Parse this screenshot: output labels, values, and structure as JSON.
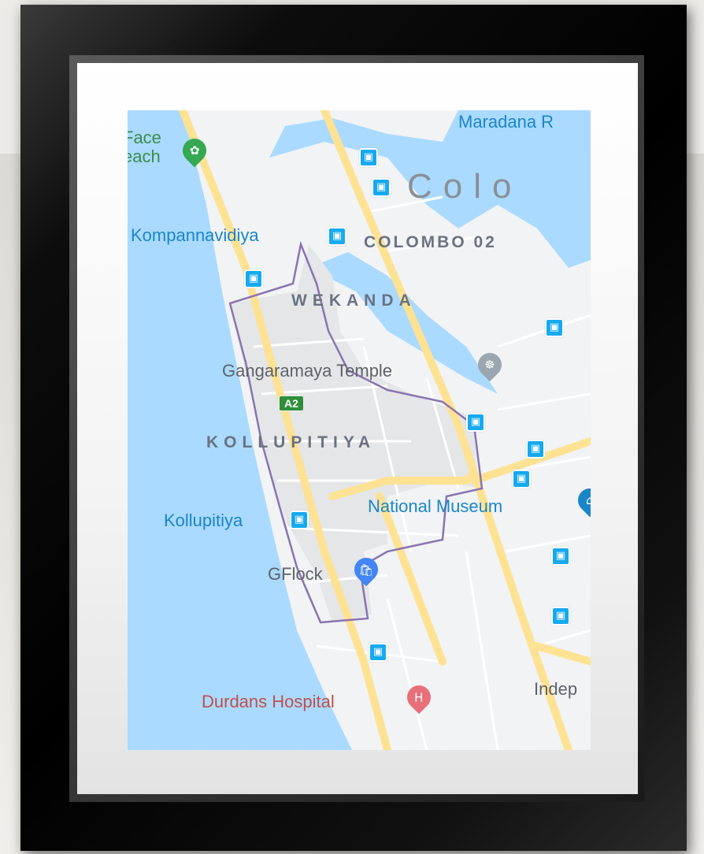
{
  "labels": {
    "maradana": "Maradana R",
    "face_beach_1": "Face",
    "face_beach_2": "each",
    "colombo_big": "Colo",
    "kompannavidiya": "Kompannavidiya",
    "colombo02": "COLOMBO 02",
    "wekanda": "WEKANDA",
    "gangaramaya": "Gangaramaya Temple",
    "a2": "A2",
    "kollupitiya_district": "KOLLUPITIYA",
    "national_museum": "National Museum",
    "kollupitiya_station": "Kollupitiya",
    "gflock": "GFlock",
    "indep": "Indep",
    "durdans": "Durdans Hospital"
  },
  "colors": {
    "water": "#aadaff",
    "land": "#f1f3f4",
    "road_major": "#fde293",
    "road_minor": "#ffffff",
    "boundary": "#8a74b0",
    "bus_icon": "#16a9f0",
    "hospital_pin": "#e8707a",
    "temple_pin": "#9aa6b0",
    "shop_pin": "#4285f4",
    "park_pin": "#34a853"
  },
  "icons": {
    "bus": "bus-stop-icon",
    "hospital": "hospital-icon",
    "temple": "temple-icon",
    "shop": "shopping-icon",
    "park": "park-icon",
    "museum": "museum-icon"
  }
}
